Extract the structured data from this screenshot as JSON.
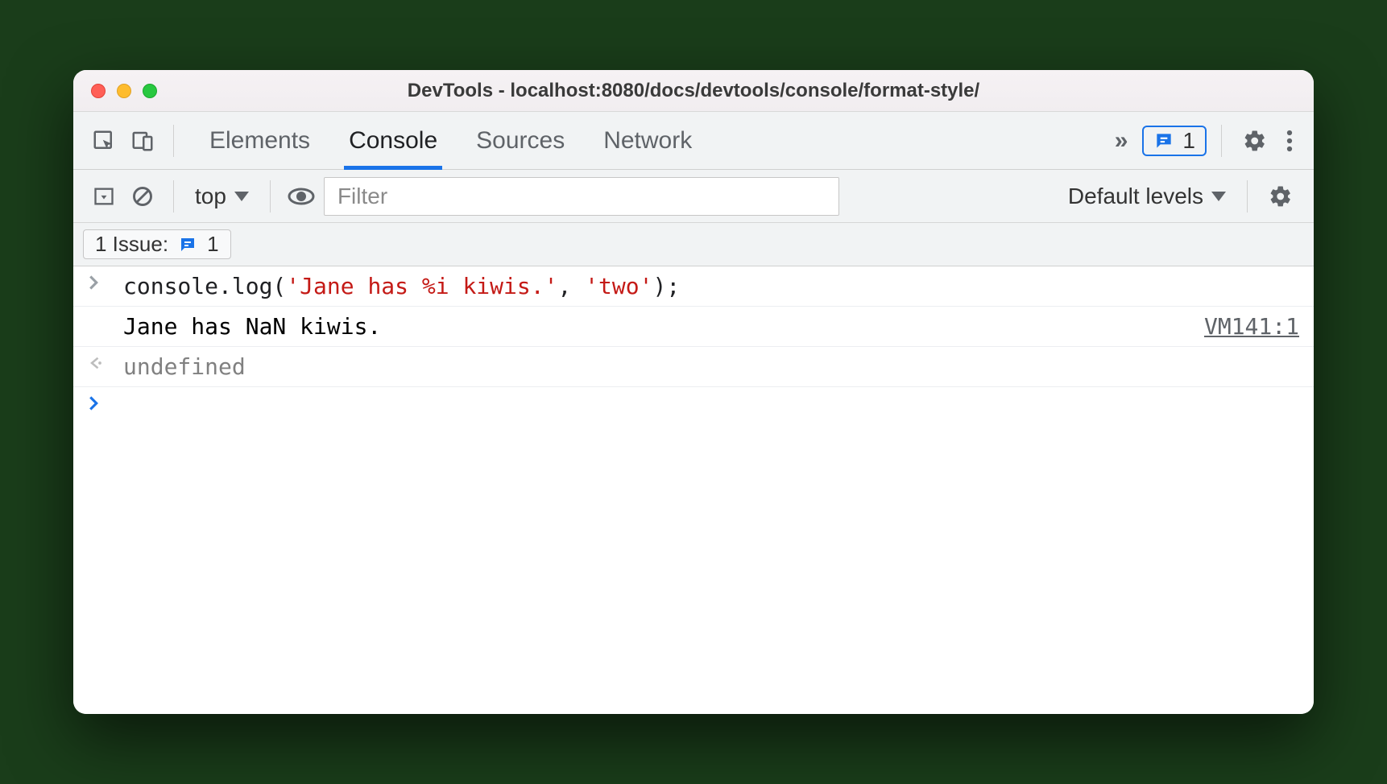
{
  "window": {
    "title": "DevTools - localhost:8080/docs/devtools/console/format-style/"
  },
  "tabs": {
    "elements": "Elements",
    "console": "Console",
    "sources": "Sources",
    "network": "Network",
    "overflow": "»"
  },
  "badge": {
    "count": "1"
  },
  "toolbar": {
    "context": "top",
    "filter_placeholder": "Filter",
    "levels": "Default levels"
  },
  "issues": {
    "label": "1 Issue:",
    "count": "1"
  },
  "console": {
    "input_prefix": "console.log(",
    "input_str1": "'Jane has %i kiwis.'",
    "input_sep": ", ",
    "input_str2": "'two'",
    "input_suffix": ");",
    "output_text": "Jane has NaN kiwis.",
    "output_source": "VM141:1",
    "return_value": "undefined"
  }
}
